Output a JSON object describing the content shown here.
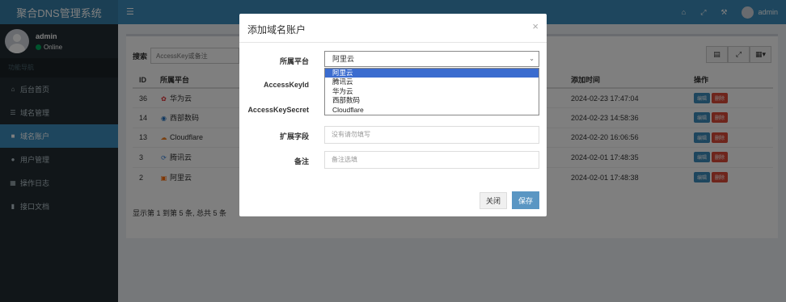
{
  "app": {
    "title": "聚合DNS管理系统"
  },
  "user": {
    "name": "admin",
    "status": "Online"
  },
  "sidebar": {
    "header": "功能导航",
    "items": [
      {
        "label": "后台首页",
        "icon": "home-icon"
      },
      {
        "label": "域名管理",
        "icon": "list-icon"
      },
      {
        "label": "域名账户",
        "icon": "lock-icon"
      },
      {
        "label": "用户管理",
        "icon": "user-icon"
      },
      {
        "label": "操作日志",
        "icon": "table-icon"
      },
      {
        "label": "接口文档",
        "icon": "book-icon"
      }
    ]
  },
  "header": {
    "user_name": "admin"
  },
  "toolbar": {
    "search_label": "搜索",
    "search_placeholder": "AccessKey或备注"
  },
  "table": {
    "headers": {
      "id": "ID",
      "platform": "所属平台",
      "time": "添加时间",
      "actions": "操作"
    },
    "rows": [
      {
        "id": "36",
        "platform": "华为云",
        "time": "2024-02-23 17:47:04",
        "icon_color": "#e0292e"
      },
      {
        "id": "14",
        "platform": "西部数码",
        "time": "2024-02-23 14:58:36",
        "icon_color": "#1f6fbf"
      },
      {
        "id": "13",
        "platform": "Cloudflare",
        "time": "2024-02-20 16:06:56",
        "icon_color": "#f38020"
      },
      {
        "id": "3",
        "platform": "腾讯云",
        "time": "2024-02-01 17:48:35",
        "icon_color": "#2b7bd8"
      },
      {
        "id": "2",
        "platform": "阿里云",
        "time": "2024-02-01 17:48:38",
        "icon_color": "#ff6a00"
      }
    ],
    "edit_label": "编辑",
    "delete_label": "删除"
  },
  "pager": {
    "text": "显示第 1 到第 5 条, 总共 5 条"
  },
  "modal": {
    "title": "添加域名账户",
    "close_glyph": "×",
    "labels": {
      "platform": "所属平台",
      "access_key_id": "AccessKeyId",
      "access_key_secret": "AccessKeySecret",
      "extra": "扩展字段",
      "remark": "备注"
    },
    "platform_selected": "阿里云",
    "platform_options": [
      "阿里云",
      "腾讯云",
      "华为云",
      "西部数码",
      "Cloudflare"
    ],
    "extra_placeholder": "没有请勿填写",
    "remark_placeholder": "备注选填",
    "close_button": "关闭",
    "save_button": "保存"
  }
}
